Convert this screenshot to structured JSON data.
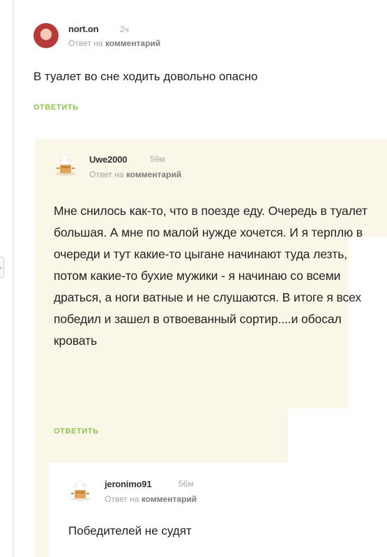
{
  "comments": [
    {
      "author": "nort.on",
      "time": "2ч",
      "reply_prefix": "Ответ на",
      "reply_target": "комментарий",
      "text": "В туалет во сне ходить довольно опасно",
      "reply_label": "ОТВЕТИТЬ",
      "avatar_icon": "user-photo-avatar"
    },
    {
      "author": "Uwe2000",
      "time": "59м",
      "reply_prefix": "Ответ на",
      "reply_target": "комментарий",
      "text": "Мне снилось как-то, что в поезде еду. Очередь в туалет большая. А мне по малой нужде хочется.  И я терплю в очереди и тут какие-то цыгане начинают туда лезть, потом какие-то бухие мужики - я начинаю со всеми драться, а ноги ватные и не слушаются. В итоге я всех победил и зашел в отвоеванный сортир....и обосал кровать",
      "reply_label": "ОТВЕТИТЬ",
      "avatar_icon": "chef-avatar-icon"
    },
    {
      "author": "jeronimo91",
      "time": "56м",
      "reply_prefix": "Ответ на",
      "reply_target": "комментарий",
      "text": "Победителей не судят",
      "avatar_icon": "chef-avatar-icon"
    }
  ],
  "colors": {
    "reply_button": "#8dc44f",
    "nested_background": "#fbf7e8",
    "thread_line": "#ececec"
  }
}
